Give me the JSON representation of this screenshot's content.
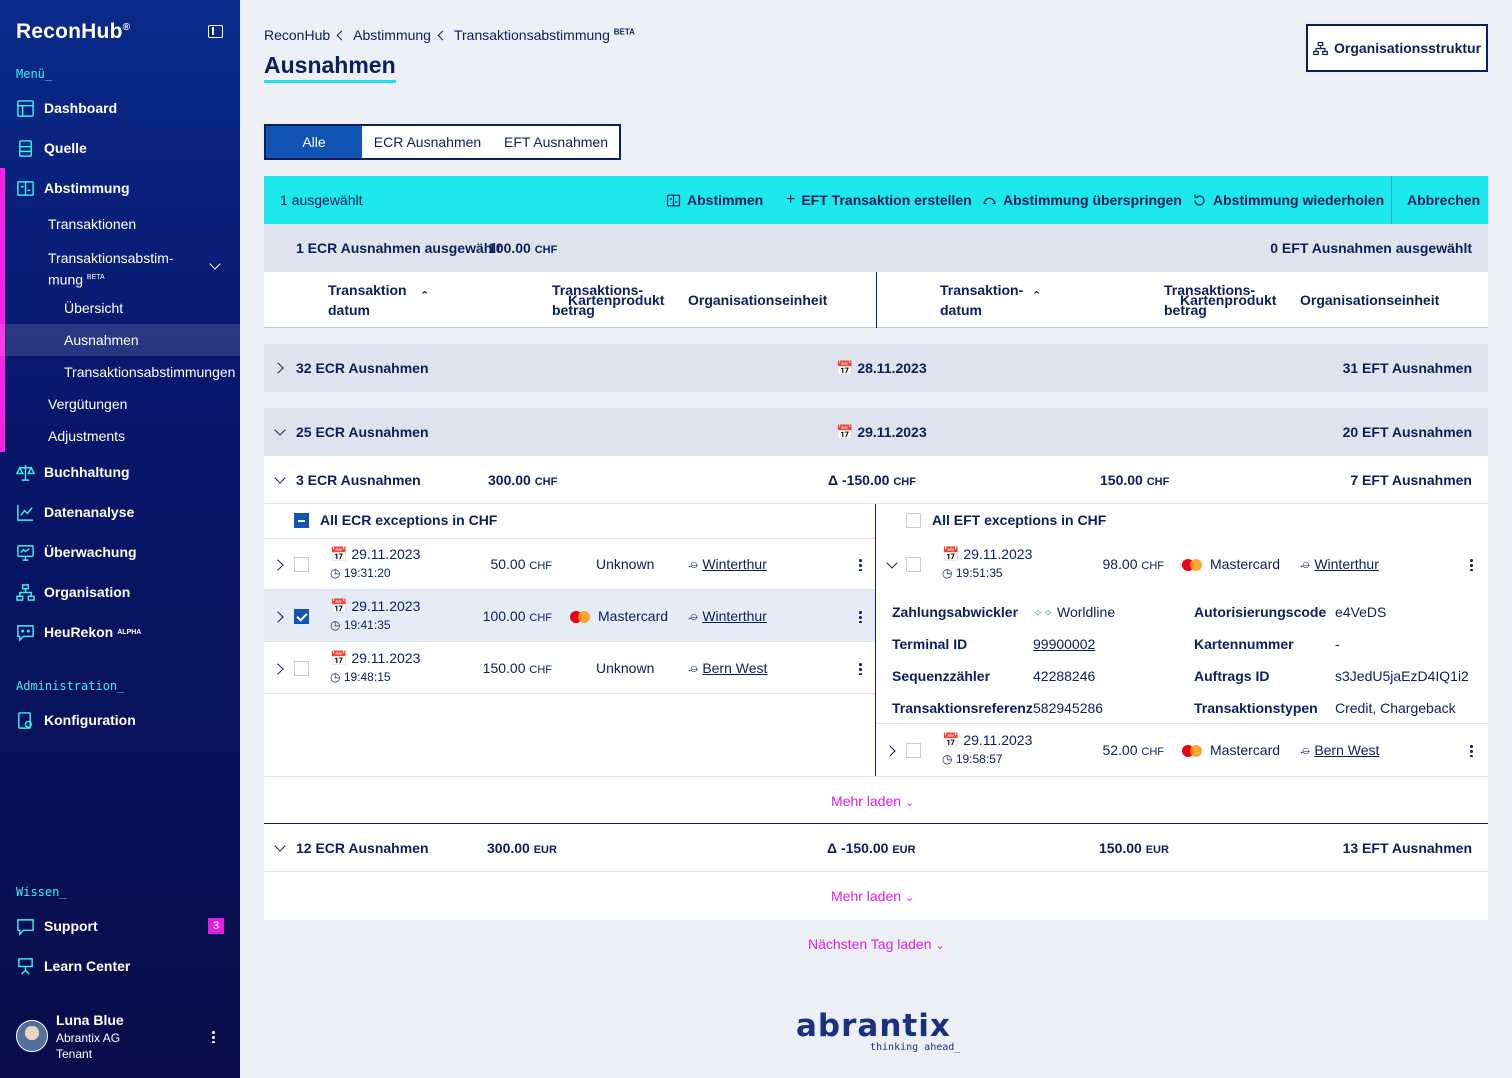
{
  "sidebar": {
    "logo": "ReconHub",
    "logo_mark": "®",
    "menu_section": "Menü_",
    "items": [
      {
        "label": "Dashboard",
        "icon": "dashboard-icon"
      },
      {
        "label": "Quelle",
        "icon": "document-icon"
      },
      {
        "label": "Abstimmung",
        "icon": "reconcile-icon"
      }
    ],
    "sub_items": [
      "Transaktionen",
      "Transaktionsabstim-",
      "mung",
      "Übersicht",
      "Ausnahmen",
      "Transaktionsabstimmungen",
      "Vergütungen",
      "Adjustments"
    ],
    "beta": "BETA",
    "items2": [
      {
        "label": "Buchhaltung",
        "icon": "scale-icon"
      },
      {
        "label": "Datenanalyse",
        "icon": "chart-icon"
      },
      {
        "label": "Überwachung",
        "icon": "monitor-icon"
      },
      {
        "label": "Organisation",
        "icon": "org-icon"
      },
      {
        "label": "HeuRekon",
        "icon": "chat-icon"
      }
    ],
    "alpha": "ALPHA",
    "admin_section": "Administration_",
    "konfiguration": "Konfiguration",
    "wissen_section": "Wissen_",
    "support": "Support",
    "support_badge": "3",
    "learn": "Learn Center",
    "user_name": "Luna Blue",
    "user_org": "Abrantix AG",
    "user_role": "Tenant"
  },
  "breadcrumb": [
    "ReconHub",
    "Abstimmung",
    "Transaktionsabstimmung"
  ],
  "breadcrumb_beta": "BETA",
  "page_title": "Ausnahmen",
  "org_button": "Organisationsstruktur",
  "tabs": [
    "Alle",
    "ECR Ausnahmen",
    "EFT Ausnahmen"
  ],
  "actions": {
    "selected": "1 ausgewählt",
    "abstimmen": "Abstimmen",
    "create": "EFT Transaktion erstellen",
    "skip": "Abstimmung überspringen",
    "repeat": "Abstimmung wiederholen",
    "cancel": "Abbrechen"
  },
  "selection": {
    "ecr": "1 ECR Ausnahmen ausgewählt",
    "ecr_amount": "100.00",
    "currency": "CHF",
    "eft": "0 EFT Ausnahmen ausgewählt"
  },
  "columns": {
    "date1": "Transaktion",
    "date2": "datum",
    "date_r1": "Transaktion-",
    "date_r2": "datum",
    "amount1": "Transaktions-",
    "amount2": "betrag",
    "card": "Kartenprodukt",
    "org": "Organisationseinheit"
  },
  "groups": [
    {
      "left": "32 ECR Ausnahmen",
      "date": "28.11.2023",
      "right": "31 EFT Ausnahmen"
    },
    {
      "left": "25 ECR Ausnahmen",
      "date": "29.11.2023",
      "right": "20 EFT Ausnahmen"
    }
  ],
  "subgroup_chf": {
    "left": "3 ECR Ausnahmen",
    "left_amt": "300.00",
    "delta": "Δ -150.00",
    "right_amt": "150.00",
    "right": "7 EFT Ausnahmen",
    "cur": "CHF"
  },
  "all_ecr": "All ECR exceptions in CHF",
  "all_eft": "All EFT exceptions in CHF",
  "ecr_rows": [
    {
      "date": "29.11.2023",
      "time": "19:31:20",
      "amount": "50.00",
      "card": "Unknown",
      "org": "Winterthur"
    },
    {
      "date": "29.11.2023",
      "time": "19:41:35",
      "amount": "100.00",
      "card": "Mastercard",
      "org": "Winterthur"
    },
    {
      "date": "29.11.2023",
      "time": "19:48:15",
      "amount": "150.00",
      "card": "Unknown",
      "org": "Bern West"
    }
  ],
  "eft_rows": [
    {
      "date": "29.11.2023",
      "time": "19:51:35",
      "amount": "98.00",
      "card": "Mastercard",
      "org": "Winterthur"
    },
    {
      "date": "29.11.2023",
      "time": "19:58:57",
      "amount": "52.00",
      "card": "Mastercard",
      "org": "Bern West"
    }
  ],
  "details": {
    "k1": "Zahlungsabwickler",
    "v1": "Worldline",
    "k2": "Terminal ID",
    "v2": "99900002",
    "k3": "Sequenzzähler",
    "v3": "42288246",
    "k4": "Transaktionsreferenz",
    "v4": "582945286",
    "k5": "Autorisierungscode",
    "v5": "e4VeDS",
    "k6": "Kartennummer",
    "v6": "-",
    "k7": "Auftrags ID",
    "v7": "s3JedU5jaEzD4IQ1i2",
    "k8": "Transaktionstypen",
    "v8": "Credit, Chargeback"
  },
  "mehr_laden": "Mehr laden",
  "subgroup_eur": {
    "left": "12 ECR Ausnahmen",
    "left_amt": "300.00",
    "delta": "Δ -150.00",
    "right_amt": "150.00",
    "right": "13 EFT Ausnahmen",
    "cur": "EUR"
  },
  "next_day": "Nächsten Tag laden",
  "footer_logo": "abrantix",
  "footer_tagline": "thinking ahead_",
  "colors": {
    "accent": "#1de8ec",
    "primary": "#0a1f5c",
    "active_tab": "#1254b4",
    "magenta": "#e020e0"
  }
}
